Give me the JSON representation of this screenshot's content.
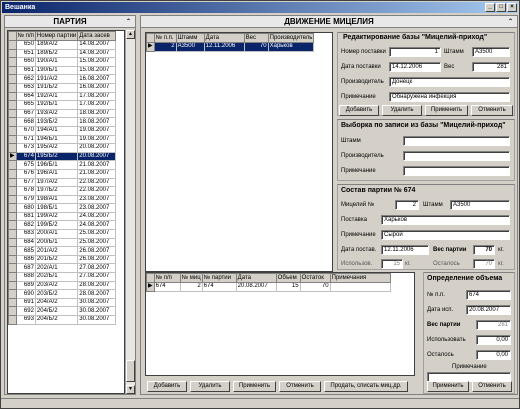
{
  "window": {
    "title": "Вешанка"
  },
  "partiya": {
    "header": "ПАРТИЯ",
    "columns": [
      "№ п/п",
      "Номер партии",
      "Дата засев"
    ],
    "rows": [
      [
        "650",
        "189/A/2",
        "14.08.2007"
      ],
      [
        "651",
        "189/Б/2",
        "14.08.2007"
      ],
      [
        "660",
        "190/A/1",
        "15.08.2007"
      ],
      [
        "661",
        "190/Б/1",
        "15.08.2007"
      ],
      [
        "662",
        "191/A/2",
        "16.08.2007"
      ],
      [
        "663",
        "191/Б/2",
        "16.08.2007"
      ],
      [
        "664",
        "192/A/1",
        "17.08.2007"
      ],
      [
        "665",
        "192/Б/1",
        "17.08.2007"
      ],
      [
        "667",
        "193/A/2",
        "18.08.2007"
      ],
      [
        "668",
        "193/Б/2",
        "18.08.2007"
      ],
      [
        "670",
        "194/A/1",
        "19.08.2007"
      ],
      [
        "671",
        "194/Б/1",
        "19.08.2007"
      ],
      [
        "673",
        "195/A/2",
        "20.08.2007"
      ],
      [
        "674",
        "195/Б/2",
        "20.08.2007"
      ],
      [
        "675",
        "196/Б/1",
        "21.08.2007"
      ],
      [
        "676",
        "196/A/1",
        "21.08.2007"
      ],
      [
        "677",
        "197/A/2",
        "22.08.2007"
      ],
      [
        "678",
        "197/Б/2",
        "22.08.2007"
      ],
      [
        "679",
        "198/A/1",
        "23.08.2007"
      ],
      [
        "680",
        "198/Б/1",
        "23.08.2007"
      ],
      [
        "681",
        "199/A/2",
        "24.08.2007"
      ],
      [
        "682",
        "199/Б/2",
        "24.08.2007"
      ],
      [
        "683",
        "200/A/1",
        "25.08.2007"
      ],
      [
        "684",
        "200/Б/1",
        "25.08.2007"
      ],
      [
        "685",
        "201/A/2",
        "26.08.2007"
      ],
      [
        "686",
        "201/Б/2",
        "26.08.2007"
      ],
      [
        "687",
        "202/A/1",
        "27.08.2007"
      ],
      [
        "688",
        "202/Б/1",
        "27.08.2007"
      ],
      [
        "689",
        "203/A/2",
        "28.08.2007"
      ],
      [
        "690",
        "203/Б/2",
        "28.08.2007"
      ],
      [
        "691",
        "204/A/2",
        "30.08.2007"
      ],
      [
        "692",
        "204/Б/2",
        "30.08.2007"
      ],
      [
        "693",
        "204/Б/2",
        "30.08.2007"
      ]
    ],
    "selected_row": 13
  },
  "dvizhenie": {
    "header": "ДВИЖЕНИЕ МИЦЕЛИЯ",
    "grid1": {
      "columns": [
        "№ п.п.",
        "Штамм",
        "Дата",
        "Вес",
        "Производитель"
      ],
      "rows": [
        [
          "2",
          "A3500",
          "12.11.2006",
          "70",
          "Харьков"
        ]
      ]
    },
    "edit": {
      "title": "Редактирование базы \"Мицелий-приход\"",
      "nomer_label": "Номер поставки",
      "nomer_value": "1",
      "shtamm_label": "Штамм",
      "shtamm_value": "A3500",
      "data_label": "Дата поставки",
      "data_value": "14.12.2006",
      "ves_label": "Вес",
      "ves_value": "281",
      "proizv_label": "Производитель",
      "proizv_value": "Донецк",
      "prim_label": "Примечание",
      "prim_value": "Обнаружена инфекция",
      "buttons": [
        "Добавить",
        "Удалить",
        "Применить",
        "Отменить"
      ]
    },
    "vyborka": {
      "title": "Выборка по записи из базы \"Мицелий-приход\"",
      "shtamm_label": "Штамм",
      "proizv_label": "Производитель",
      "prim_label": "Примечание"
    },
    "sostav": {
      "title": "Состав партии № 674",
      "miceliy_label": "Мицелий №",
      "miceliy_value": "2",
      "shtamm_label": "Штамм",
      "shtamm_value": "A3500",
      "postavka_label": "Поставка",
      "postavka_value": "Харьков",
      "prim_label": "Примечание",
      "prim_value": "Сырой",
      "data_label": "Дата постав.",
      "data_value": "12.11.2006",
      "ves_label": "Вес партии",
      "ves_value": "70",
      "ves_unit": "кг.",
      "isp_label": "Использов.",
      "isp_value": "15",
      "isp_unit": "кг.",
      "ost_label": "Осталось",
      "ost_value": "70",
      "ost_unit": "кг."
    },
    "grid2": {
      "columns": [
        "№ п/п",
        "№ миц",
        "№ партии",
        "Дата",
        "Объем",
        "Остаток",
        "Примечания"
      ],
      "rows": [
        [
          "674",
          "2",
          "674",
          "20.08.2007",
          "15",
          "70",
          ""
        ]
      ]
    },
    "opredelenie": {
      "title": "Определение объема",
      "np_label": "№ п.п.",
      "np_value": "674",
      "data_label": "Дата исп.",
      "data_value": "20.08.2007",
      "ves_label": "Вес партии",
      "ves_value": "281",
      "isp_label": "Использовать",
      "isp_value": "0,00",
      "ost_label": "Осталось",
      "ost_value": "0,00",
      "prim_label": "Примечание",
      "primenit": "Применить",
      "otmenit": "Отменить"
    },
    "bottom_buttons": [
      "Добавить",
      "Удалить",
      "Применить",
      "Отменить",
      "Продать, списать миц.др."
    ]
  }
}
